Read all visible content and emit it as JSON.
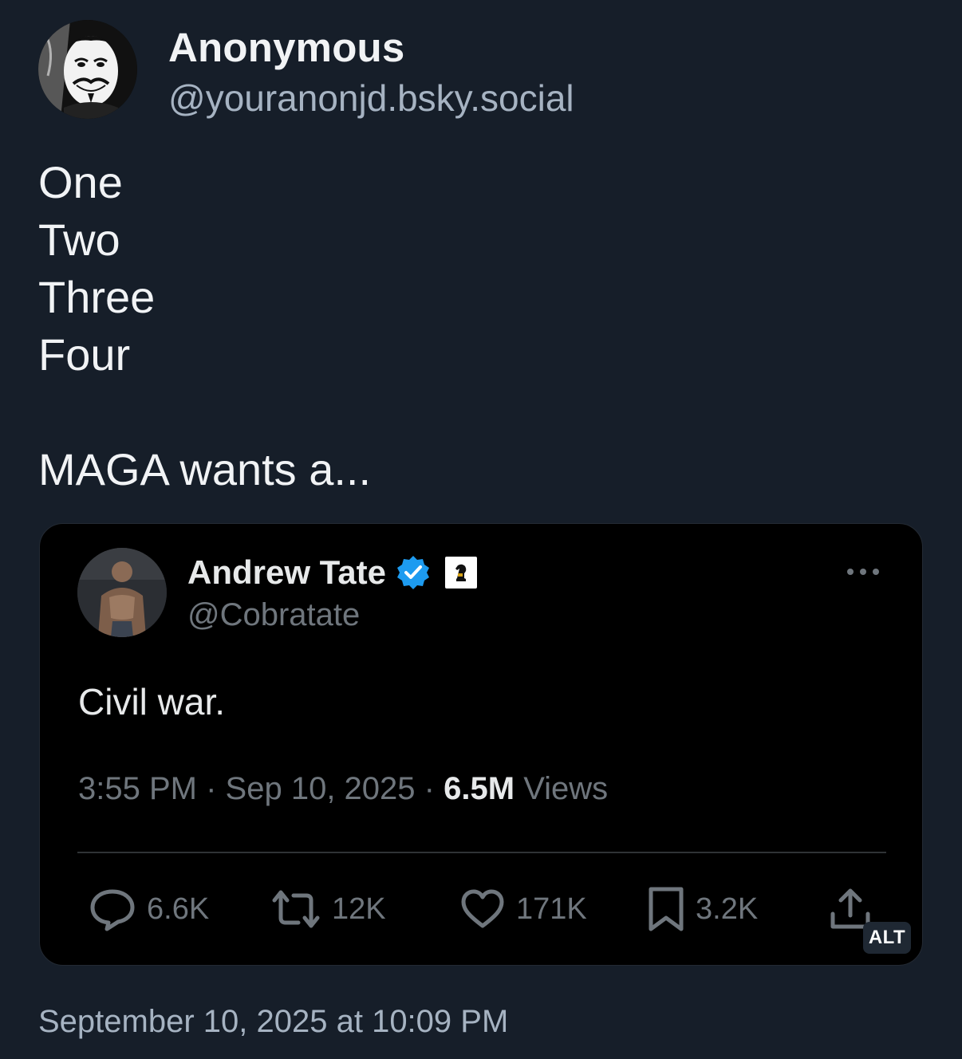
{
  "post": {
    "author": {
      "display_name": "Anonymous",
      "handle": "@youranonjd.bsky.social",
      "avatar_icon": "guy-fawkes-mask-avatar"
    },
    "body_lines": [
      "One",
      "Two",
      "Three",
      "Four",
      "",
      "MAGA wants a..."
    ],
    "timestamp": "September 10, 2025 at 10:09 PM"
  },
  "embed": {
    "author": {
      "display_name": "Andrew Tate",
      "handle": "@Cobratate",
      "verified_icon": "verified-badge-icon",
      "affiliate_icon": "chess-knight-affiliate-icon",
      "avatar_icon": "profile-photo-avatar"
    },
    "text": "Civil war.",
    "meta": {
      "time": "3:55 PM",
      "separator": "·",
      "date": "Sep 10, 2025",
      "views_count": "6.5M",
      "views_label": "Views"
    },
    "actions": {
      "replies": "6.6K",
      "reposts": "12K",
      "likes": "171K",
      "bookmarks": "3.2K"
    },
    "alt_badge": "ALT"
  },
  "colors": {
    "background": "#161e29",
    "embed_background": "#000000",
    "verified_blue": "#1d9bf0",
    "muted_text": "#6f767d",
    "handle_text": "#a6b3c2"
  }
}
